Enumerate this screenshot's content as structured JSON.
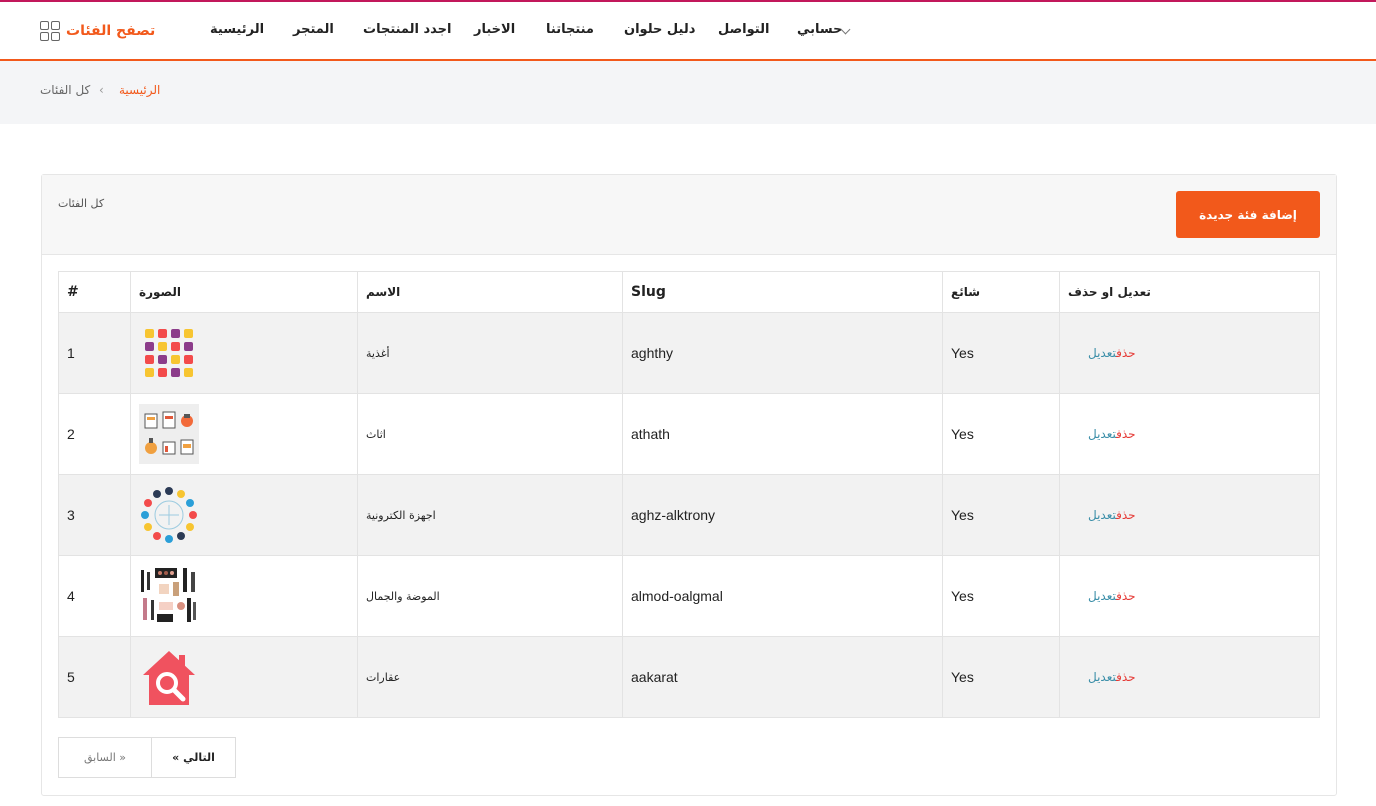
{
  "header": {
    "browse_label": "تصفح الفئات",
    "nav": [
      {
        "label": "الرئيسية"
      },
      {
        "label": "المتجر"
      },
      {
        "label": "اجدد المنتجات"
      },
      {
        "label": "الاخبار"
      },
      {
        "label": "منتجاتنا"
      },
      {
        "label": "دليل حلوان"
      },
      {
        "label": "التواصل"
      },
      {
        "label": "حسابي"
      }
    ]
  },
  "breadcrumb": {
    "home": "الرئيسية",
    "separator": "‹",
    "current": "كل الفئات"
  },
  "card": {
    "title": "كل الفئات",
    "add_button": "إضافة فئة جديدة"
  },
  "table": {
    "headers": {
      "num": "#",
      "image": "الصورة",
      "name": "الاسم",
      "slug": "Slug",
      "popular": "شائع",
      "actions": "تعديل او حذف"
    },
    "rows": [
      {
        "num": "1",
        "image": "food-icons-grid",
        "name": "أغذية",
        "slug": "aghthy",
        "popular": "Yes",
        "edit": "تعديل",
        "delete": "حذف"
      },
      {
        "num": "2",
        "image": "furniture-icons",
        "name": "اثاث",
        "slug": "athath",
        "popular": "Yes",
        "edit": "تعديل",
        "delete": "حذف"
      },
      {
        "num": "3",
        "image": "electronics-circle",
        "name": "اجهزة الكترونية",
        "slug": "aghz-alktrony",
        "popular": "Yes",
        "edit": "تعديل",
        "delete": "حذف"
      },
      {
        "num": "4",
        "image": "cosmetics",
        "name": "الموضة والجمال",
        "slug": "almod-oalgmal",
        "popular": "Yes",
        "edit": "تعديل",
        "delete": "حذف"
      },
      {
        "num": "5",
        "image": "house-search-icon",
        "name": "عقارات",
        "slug": "aakarat",
        "popular": "Yes",
        "edit": "تعديل",
        "delete": "حذف"
      }
    ]
  },
  "pagination": {
    "prev": "السابق »",
    "next": "« التالي"
  },
  "colors": {
    "accent": "#f2591b",
    "delete": "#e53935",
    "edit": "#3a8ea8",
    "house": "#f0525f"
  }
}
